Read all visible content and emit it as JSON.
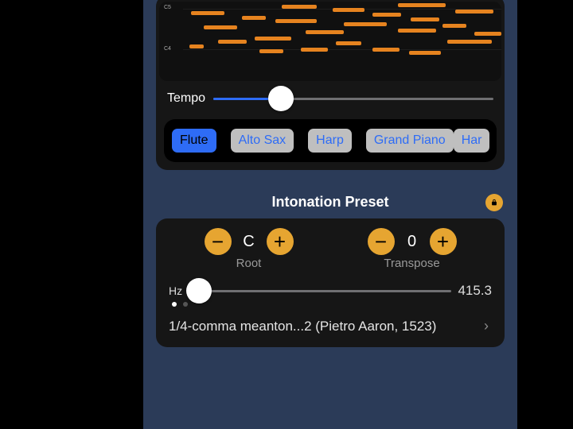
{
  "pianoRoll": {
    "labels": [
      "C5",
      "C4"
    ]
  },
  "tempo": {
    "label": "Tempo",
    "position_pct": 24
  },
  "instruments": [
    {
      "label": "Flute",
      "selected": true
    },
    {
      "label": "Alto Sax",
      "selected": false
    },
    {
      "label": "Harp",
      "selected": false
    },
    {
      "label": "Grand Piano",
      "selected": false
    },
    {
      "label": "Har",
      "selected": false
    }
  ],
  "intonation": {
    "title": "Intonation Preset",
    "root": {
      "value": "C",
      "label": "Root"
    },
    "transpose": {
      "value": "0",
      "label": "Transpose"
    },
    "hz": {
      "label": "Hz",
      "value": "415.3",
      "position_pct": 4
    },
    "preset": "1/4-comma meanton...2 (Pietro Aaron, 1523)",
    "page_dots": {
      "count": 2,
      "active": 0
    }
  },
  "colors": {
    "accent_orange": "#e6a531",
    "accent_blue": "#2e6cf6",
    "note_orange": "#e6831f"
  }
}
